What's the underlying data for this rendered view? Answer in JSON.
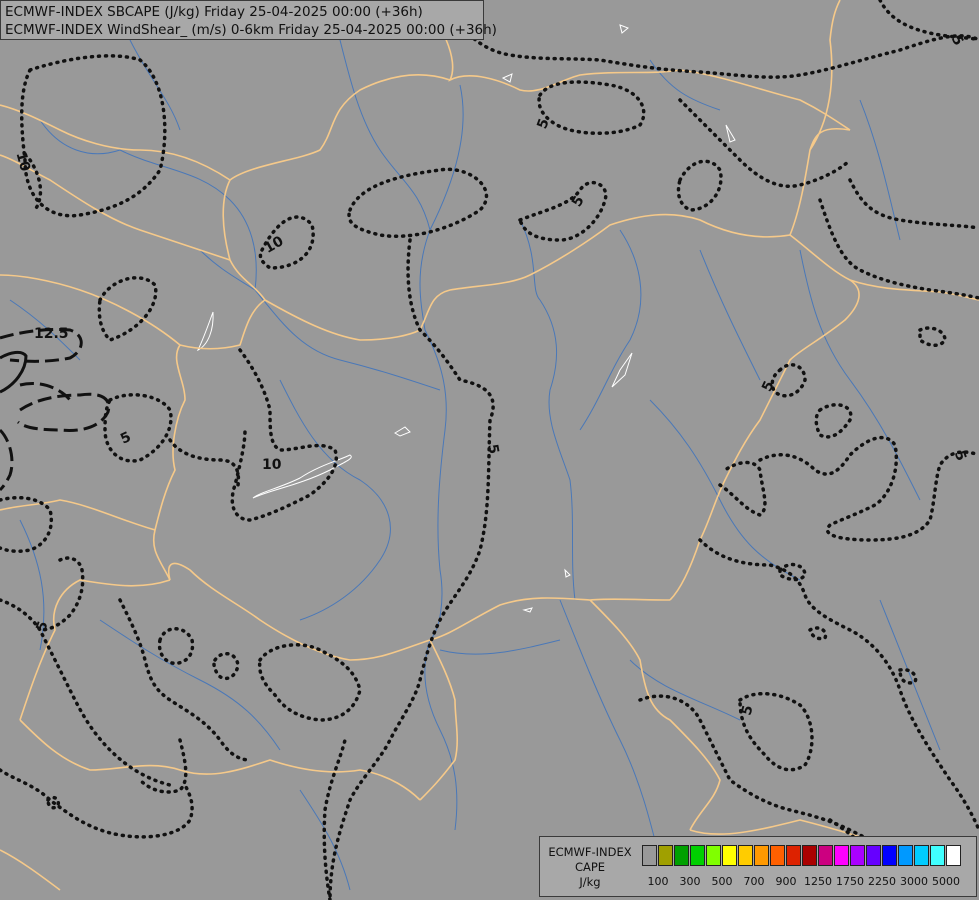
{
  "header": {
    "line1": "ECMWF-INDEX SBCAPE (J/kg) Friday 25-04-2025 00:00 (+36h)",
    "line2": "ECMWF-INDEX WindShear_ (m/s) 0-6km Friday 25-04-2025 00:00 (+36h)"
  },
  "legend": {
    "title1": "ECMWF-INDEX",
    "title2": "CAPE",
    "unit": "J/kg",
    "colors": [
      "#999999",
      "#a0a000",
      "#00a000",
      "#00d000",
      "#80ff00",
      "#ffff00",
      "#ffcc00",
      "#ff9900",
      "#ff6000",
      "#dd2200",
      "#aa0000",
      "#cc0080",
      "#ff00ff",
      "#aa00ff",
      "#6600ff",
      "#0000ff",
      "#0099ff",
      "#00ccff",
      "#40ffff",
      "#ffffff"
    ],
    "ticks": [
      "100",
      "300",
      "500",
      "700",
      "900",
      "1250",
      "1750",
      "2250",
      "3000",
      "5000"
    ]
  },
  "map": {
    "border_color": "#f5c98a",
    "river_color": "#4a78b8",
    "contour_labels": [
      "5",
      "5",
      "5",
      "5",
      "5",
      "5",
      "5",
      "5",
      "5",
      "10",
      "10",
      "10",
      "12.5"
    ]
  }
}
